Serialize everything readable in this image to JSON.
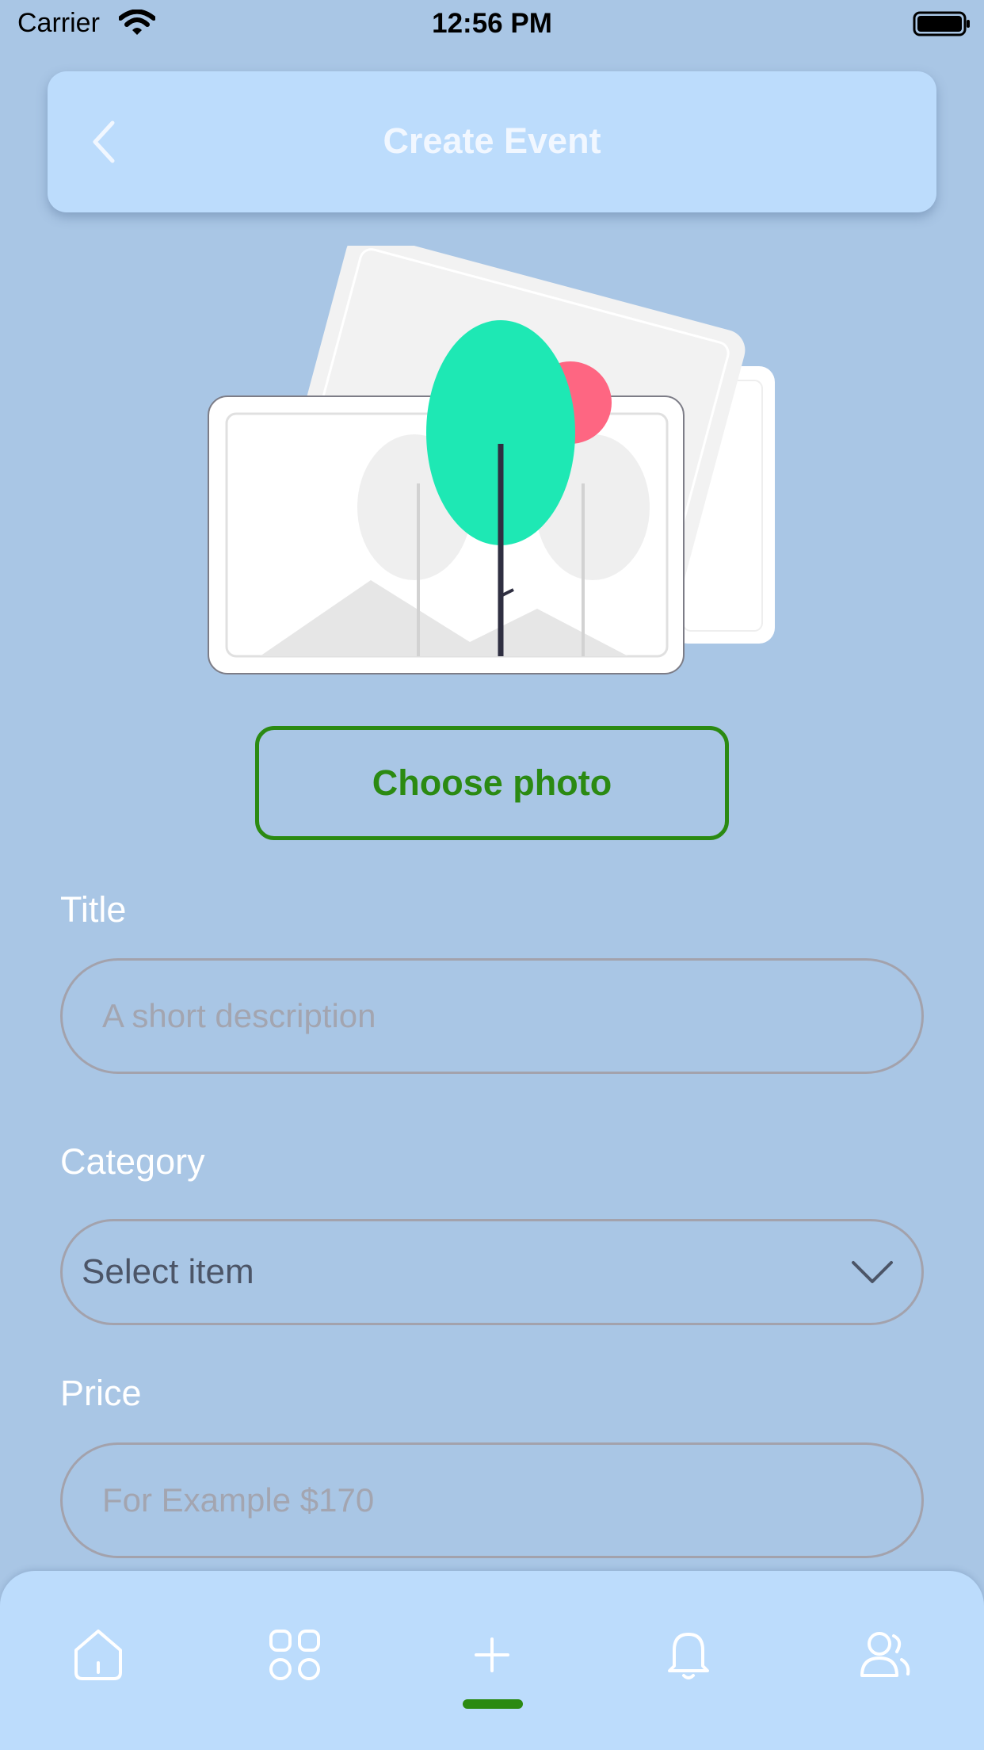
{
  "status_bar": {
    "carrier": "Carrier",
    "time": "12:56 PM"
  },
  "header": {
    "title": "Create Event",
    "back_icon": "chevron-left-icon"
  },
  "photo": {
    "button_label": "Choose photo"
  },
  "form": {
    "title": {
      "label": "Title",
      "placeholder": "A short description"
    },
    "category": {
      "label": "Category",
      "value": "Select item"
    },
    "price": {
      "label": "Price",
      "placeholder": "For Example $170"
    }
  },
  "tabbar": {
    "items": [
      {
        "icon": "home-icon",
        "active": false
      },
      {
        "icon": "grid-icon",
        "active": false
      },
      {
        "icon": "plus-icon",
        "active": true
      },
      {
        "icon": "bell-icon",
        "active": false
      },
      {
        "icon": "users-icon",
        "active": false
      }
    ]
  },
  "colors": {
    "background": "#a9c6e5",
    "panel": "#bcdcfc",
    "accent": "#2b8a12",
    "white": "#ffffff"
  }
}
